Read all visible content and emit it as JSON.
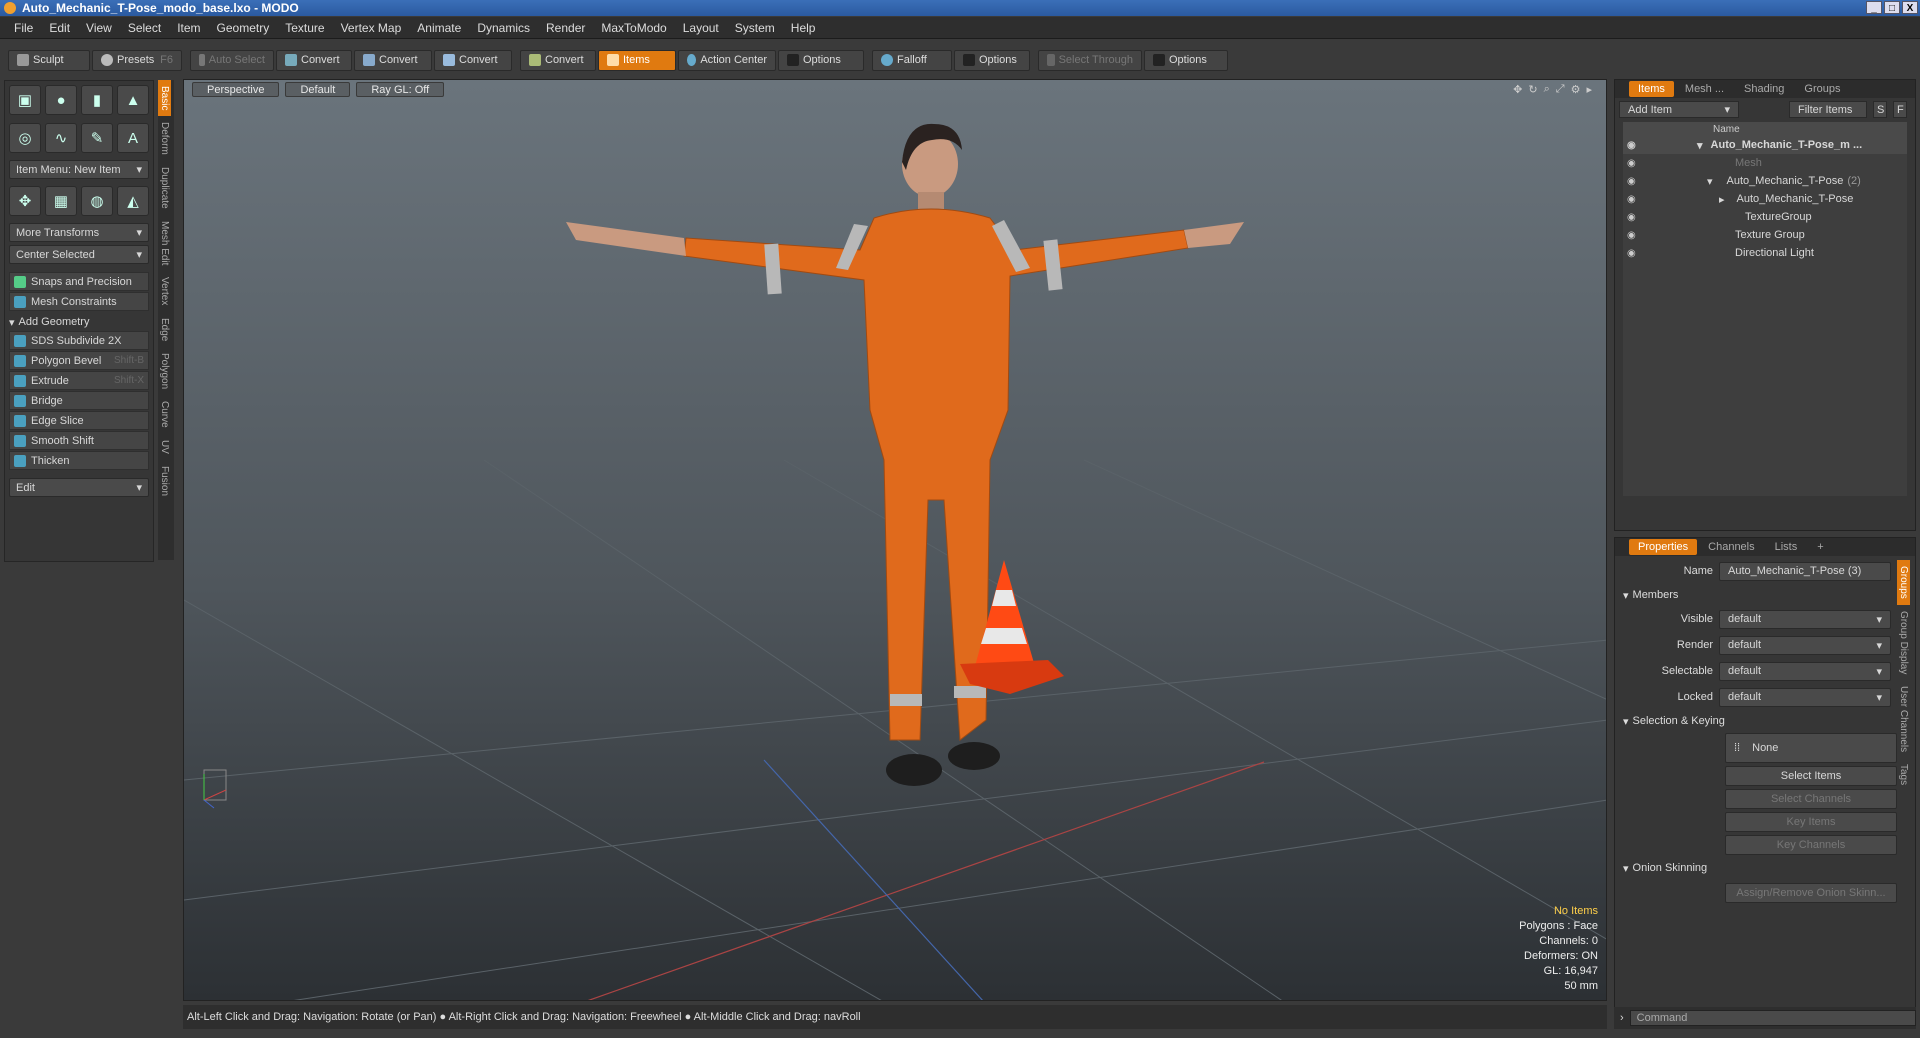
{
  "window": {
    "title": "Auto_Mechanic_T-Pose_modo_base.lxo - MODO",
    "buttons": [
      "_",
      "□",
      "X"
    ]
  },
  "menubar": [
    "File",
    "Edit",
    "View",
    "Select",
    "Item",
    "Geometry",
    "Texture",
    "Vertex Map",
    "Animate",
    "Dynamics",
    "Render",
    "MaxToModo",
    "Layout",
    "System",
    "Help"
  ],
  "toolbar": {
    "sculpt": "Sculpt",
    "presets": "Presets",
    "presets_key": "F6",
    "auto_select": "Auto Select",
    "convert1": "Convert",
    "convert2": "Convert",
    "convert3": "Convert",
    "convert4": "Convert",
    "items": "Items",
    "action_center": "Action Center",
    "options1": "Options",
    "falloff": "Falloff",
    "options2": "Options",
    "select_through": "Select Through",
    "options3": "Options"
  },
  "left": {
    "item_menu": "Item Menu: New Item",
    "more_transforms": "More Transforms",
    "center_selected": "Center Selected",
    "snaps": "Snaps and Precision",
    "mesh_constraints": "Mesh Constraints",
    "add_geometry": "Add Geometry",
    "tools": [
      {
        "label": "SDS Subdivide 2X",
        "key": ""
      },
      {
        "label": "Polygon Bevel",
        "key": "Shift-B"
      },
      {
        "label": "Extrude",
        "key": "Shift-X"
      },
      {
        "label": "Bridge",
        "key": ""
      },
      {
        "label": "Edge Slice",
        "key": ""
      },
      {
        "label": "Smooth Shift",
        "key": ""
      },
      {
        "label": "Thicken",
        "key": ""
      }
    ],
    "edit": "Edit",
    "vtabs": [
      "Basic",
      "Deform",
      "Duplicate",
      "Mesh Edit",
      "Vertex",
      "Edge",
      "Polygon",
      "Curve",
      "UV",
      "Fusion"
    ]
  },
  "viewport": {
    "view": "Perspective",
    "shading": "Default",
    "raygl": "Ray GL: Off",
    "hud": {
      "noitems": "No Items",
      "polygons": "Polygons : Face",
      "channels": "Channels: 0",
      "deformers": "Deformers: ON",
      "gl": "GL: 16,947",
      "scale": "50 mm"
    }
  },
  "status": "Alt-Left Click and Drag: Navigation: Rotate (or Pan) ● Alt-Right Click and Drag: Navigation: Freewheel ● Alt-Middle Click and Drag: navRoll",
  "items_panel": {
    "tabs": [
      "Items",
      "Mesh ...",
      "Shading",
      "Groups"
    ],
    "add_item": "Add Item",
    "filter": "Filter Items",
    "s": "S",
    "f": "F",
    "col_name": "Name",
    "tree": [
      {
        "label": "Auto_Mechanic_T-Pose_m ...",
        "indent": 0,
        "bold": true
      },
      {
        "label": "Mesh",
        "indent": 2,
        "dim": true
      },
      {
        "label": "Auto_Mechanic_T-Pose",
        "indent": 1,
        "suffix": "(2)"
      },
      {
        "label": "Auto_Mechanic_T-Pose",
        "indent": 2
      },
      {
        "label": "TextureGroup",
        "indent": 2
      },
      {
        "label": "Texture Group",
        "indent": 1
      },
      {
        "label": "Directional Light",
        "indent": 1
      }
    ]
  },
  "props_panel": {
    "tabs": [
      "Properties",
      "Channels",
      "Lists",
      "+"
    ],
    "name_label": "Name",
    "name_value": "Auto_Mechanic_T-Pose (3)",
    "members": "Members",
    "visible_label": "Visible",
    "visible_value": "default",
    "render_label": "Render",
    "render_value": "default",
    "selectable_label": "Selectable",
    "selectable_value": "default",
    "locked_label": "Locked",
    "locked_value": "default",
    "selection_keying": "Selection & Keying",
    "none": "None",
    "select_items": "Select Items",
    "select_channels": "Select Channels",
    "key_items": "Key Items",
    "key_channels": "Key Channels",
    "onion": "Onion Skinning",
    "assign_onion": "Assign/Remove Onion Skinn...",
    "side_tabs": [
      "Groups",
      "Group Display",
      "User Channels",
      "Tags"
    ]
  },
  "command": {
    "placeholder": "Command"
  }
}
